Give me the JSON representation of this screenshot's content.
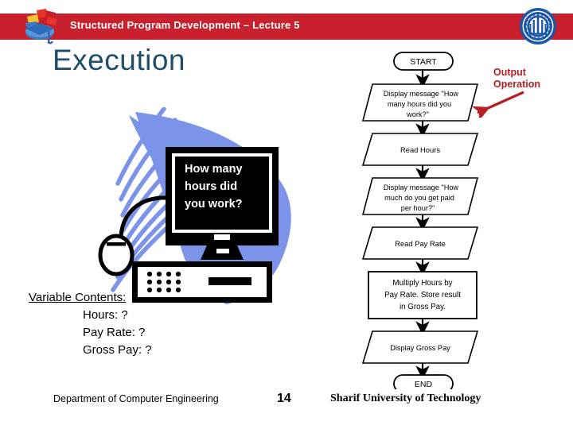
{
  "header": {
    "title": "Structured Program Development – Lecture 5",
    "bar_color": "#C8202C",
    "left_logo": "graduation-cap-logo",
    "right_logo": "sharif-university-seal"
  },
  "slide": {
    "title": "Execution",
    "title_color": "#1F4E6B"
  },
  "clipart": {
    "name": "desktop-computer-illustration",
    "monitor_lines": [
      "How many",
      "hours did",
      "you work?"
    ],
    "swoosh_color": "#7B93E8"
  },
  "variables": {
    "heading": "Variable Contents:",
    "items": [
      "Hours: ?",
      "Pay Rate: ?",
      "Gross Pay: ?"
    ]
  },
  "annotation": {
    "line1": "Output",
    "line2": "Operation",
    "color": "#B52025",
    "arrow": "red-arrow-pointing-down-left"
  },
  "flowchart": {
    "nodes": [
      {
        "id": "start",
        "shape": "terminator",
        "lines": [
          "START"
        ]
      },
      {
        "id": "msg-hours",
        "shape": "parallelogram",
        "lines": [
          "Display message \"How",
          "many hours did you",
          "work?\""
        ]
      },
      {
        "id": "read-hours",
        "shape": "parallelogram",
        "lines": [
          "Read Hours"
        ]
      },
      {
        "id": "msg-rate",
        "shape": "parallelogram",
        "lines": [
          "Display message \"How",
          "much do you get paid",
          "per hour?\""
        ]
      },
      {
        "id": "read-rate",
        "shape": "parallelogram",
        "lines": [
          "Read Pay Rate"
        ]
      },
      {
        "id": "multiply",
        "shape": "process",
        "lines": [
          "Multiply Hours by",
          "Pay Rate. Store result",
          "in Gross Pay."
        ]
      },
      {
        "id": "display-pay",
        "shape": "parallelogram",
        "lines": [
          "Display Gross Pay"
        ]
      },
      {
        "id": "end",
        "shape": "terminator",
        "lines": [
          "END"
        ]
      }
    ]
  },
  "footer": {
    "left": "Department of Computer Engineering",
    "page": "14",
    "right": "Sharif University of Technology"
  }
}
